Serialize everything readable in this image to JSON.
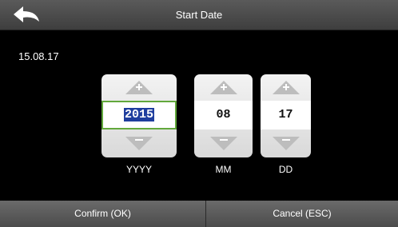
{
  "header": {
    "title": "Start Date",
    "back_icon": "back-arrow-icon"
  },
  "current_date": "15.08.17",
  "fields": {
    "year": {
      "value": "2015",
      "unit": "YYYY",
      "selected": true
    },
    "month": {
      "value": "08",
      "unit": "MM"
    },
    "day": {
      "value": "17",
      "unit": "DD"
    }
  },
  "footer": {
    "confirm_label": "Confirm (OK)",
    "cancel_label": "Cancel (ESC)"
  },
  "colors": {
    "selection_border": "#62a83c",
    "selection_fill": "#1f3e9e"
  }
}
